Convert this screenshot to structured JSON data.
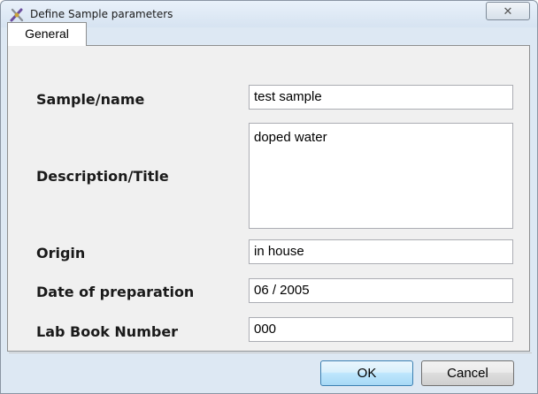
{
  "window": {
    "title": "Define Sample parameters",
    "app_icon": "sample-tool-icon",
    "close_glyph": "✕"
  },
  "tabs": [
    {
      "label": "General",
      "selected": true
    }
  ],
  "form": {
    "sample_name": {
      "label": "Sample/name",
      "value": "test sample"
    },
    "description": {
      "label": "Description/Title",
      "value": "doped water"
    },
    "origin": {
      "label": "Origin",
      "value": "in house"
    },
    "date": {
      "label": "Date of preparation",
      "value": "06 / 2005"
    },
    "lab_book": {
      "label": "Lab Book Number",
      "value": "000"
    }
  },
  "buttons": {
    "ok": "OK",
    "cancel": "Cancel"
  }
}
